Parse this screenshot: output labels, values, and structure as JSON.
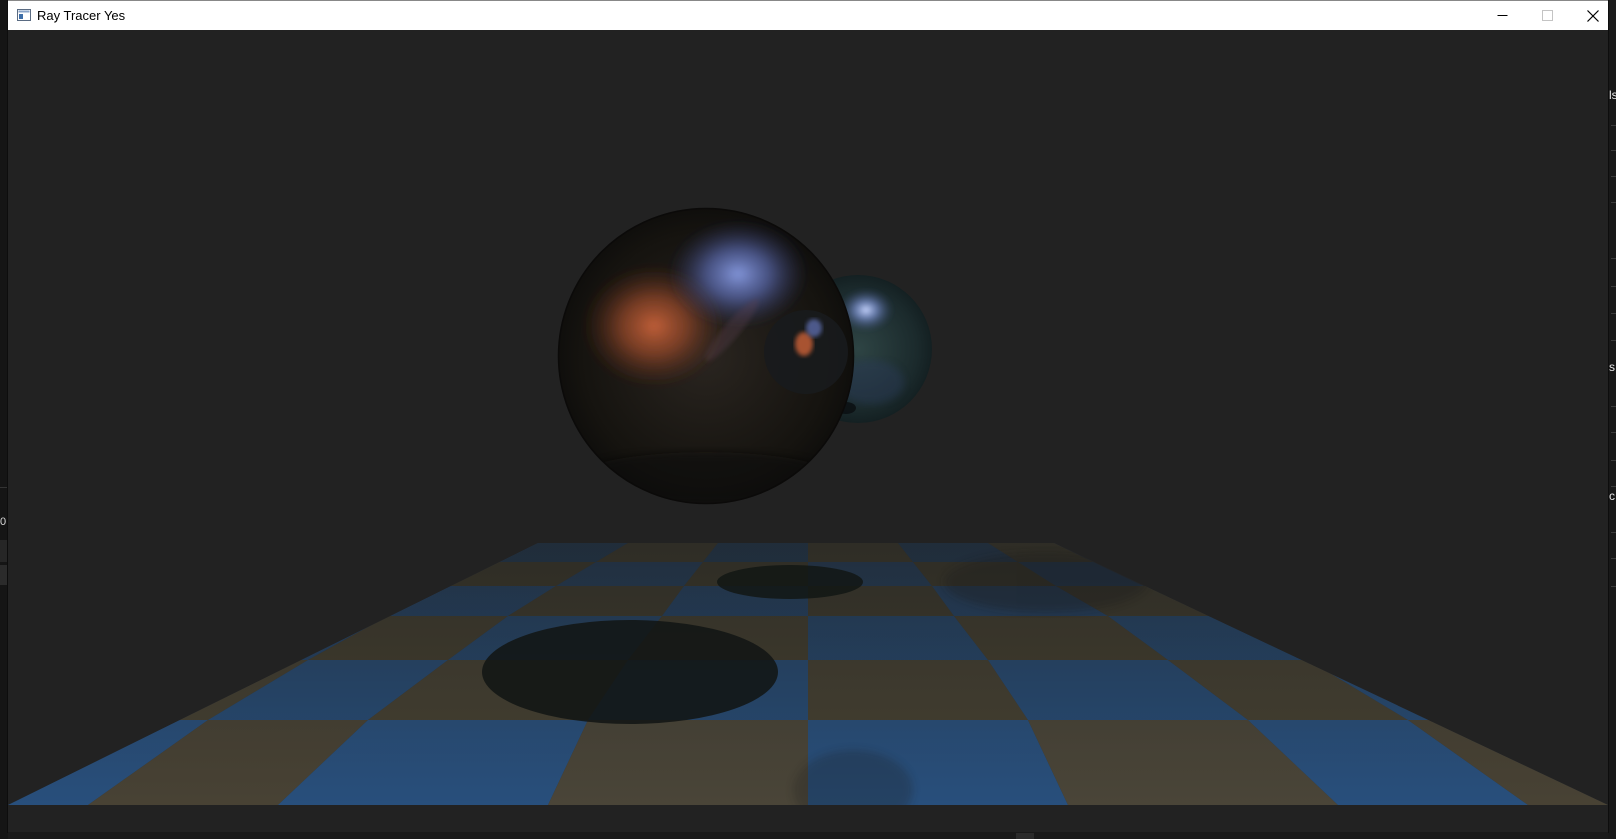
{
  "window": {
    "title": "Ray Tracer Yes",
    "icon": "app-window-icon",
    "controls": {
      "minimize_icon": "minimize-icon",
      "maximize_icon": "maximize-icon",
      "close_icon": "close-icon"
    }
  },
  "background_app": {
    "left_marks": [
      "0"
    ],
    "right_marks": [
      "ls",
      "s",
      "c"
    ]
  },
  "scene": {
    "background_color": "#222222",
    "floor": {
      "pattern": "checkerboard",
      "colors": [
        "#2a4a70",
        "#5a5238"
      ]
    },
    "spheres": [
      {
        "name": "large-reflective-sphere",
        "highlights": [
          "#d06840",
          "#7a8ee0"
        ]
      },
      {
        "name": "small-teal-sphere",
        "highlights": [
          "#a0b8f0"
        ]
      }
    ]
  }
}
